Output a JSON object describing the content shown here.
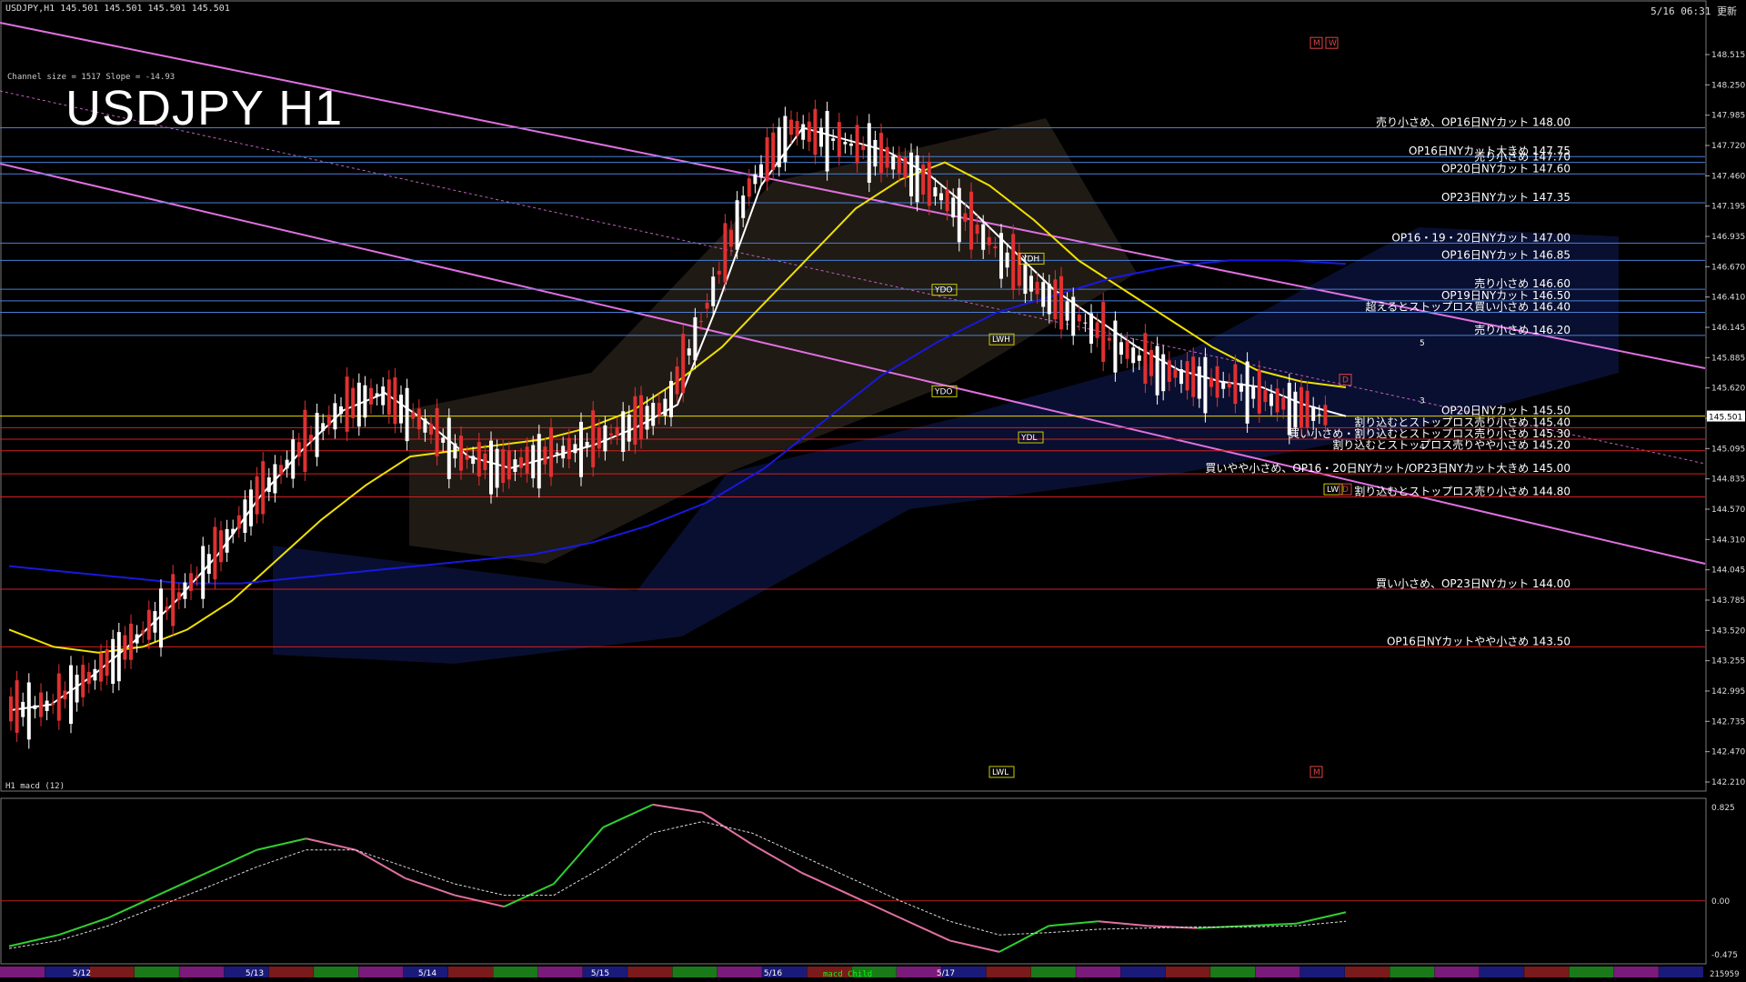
{
  "header": {
    "symbol_line": "USDJPY,H1  145.501 145.501 145.501 145.501",
    "server_time": "5/16 06:31 更新",
    "big_title": "USDJPY H1",
    "channel_info": "Channel size = 1517 Slope = -14.93"
  },
  "chart_data": {
    "type": "line",
    "symbol": "USDJPY",
    "timeframe": "H1",
    "y_axis": {
      "range": [
        142.25,
        148.95
      ],
      "tick_labels": [
        "148.515",
        "148.250",
        "147.985",
        "147.720",
        "147.460",
        "147.195",
        "146.935",
        "146.670",
        "146.410",
        "146.145",
        "145.885",
        "145.620",
        "145.360",
        "145.095",
        "144.835",
        "144.570",
        "144.310",
        "144.045",
        "143.785",
        "143.520",
        "143.255",
        "142.995",
        "142.735",
        "142.470",
        "142.210"
      ]
    },
    "current_price": "145.501",
    "x_axis": {
      "tick_labels": [
        "5/12",
        "5/13",
        "5/14",
        "5/15",
        "5/16",
        "5/17"
      ]
    },
    "levels": [
      {
        "price": 148.0,
        "label": "売り小さめ、OP16日NYカット 148.00",
        "color": "#4a7fd6"
      },
      {
        "price": 147.75,
        "label": "OP16日NYカット大きめ 147.75",
        "color": "#4a7fd6"
      },
      {
        "price": 147.7,
        "label": "売り小さめ 147.70",
        "color": "#4a7fd6"
      },
      {
        "price": 147.6,
        "label": "OP20日NYカット 147.60",
        "color": "#4a7fd6"
      },
      {
        "price": 147.35,
        "label": "OP23日NYカット 147.35",
        "color": "#4a7fd6"
      },
      {
        "price": 147.0,
        "label": "OP16・19・20日NYカット 147.00",
        "color": "#4a7fd6"
      },
      {
        "price": 146.85,
        "label": "OP16日NYカット 146.85",
        "color": "#4a7fd6"
      },
      {
        "price": 146.6,
        "label": "売り小さめ 146.60",
        "color": "#4a7fd6"
      },
      {
        "price": 146.5,
        "label": "OP19日NYカット 146.50",
        "color": "#4a7fd6"
      },
      {
        "price": 146.4,
        "label": "超えるとストップロス買い小さめ 146.40",
        "color": "#4a7fd6"
      },
      {
        "price": 146.2,
        "label": "売り小さめ 146.20",
        "color": "#4a7fd6"
      },
      {
        "price": 145.5,
        "label": "OP20日NYカット 145.50",
        "color": "#e8d800"
      },
      {
        "price": 145.4,
        "label": "割り込むとストップロス売り小さめ 145.40",
        "color": "#d42020"
      },
      {
        "price": 145.3,
        "label": "買い小さめ・割り込むとストップロス売り小さめ 145.30",
        "color": "#d42020"
      },
      {
        "price": 145.2,
        "label": "割り込むとストップロス売りやや小さめ 145.20",
        "color": "#d42020"
      },
      {
        "price": 145.0,
        "label": "買いやや小さめ、OP16・20日NYカット/OP23日NYカット大きめ 145.00",
        "color": "#d42020"
      },
      {
        "price": 144.8,
        "label": "割り込むとストップロス売り小さめ 144.80",
        "color": "#d42020"
      },
      {
        "price": 144.0,
        "label": "買い小さめ、OP23日NYカット 144.00",
        "color": "#d42020"
      },
      {
        "price": 143.5,
        "label": "OP16日NYカットやや小さめ 143.50",
        "color": "#d42020"
      }
    ],
    "markers": [
      {
        "text": "YDH",
        "price": 146.85
      },
      {
        "text": "YDO",
        "price": 146.58
      },
      {
        "text": "YDO",
        "price": 145.7
      },
      {
        "text": "YDL",
        "price": 145.3
      },
      {
        "text": "LWH",
        "price": 146.15
      },
      {
        "text": "LWL",
        "price": 142.4
      },
      {
        "text": "D",
        "price": 145.8
      },
      {
        "text": "M",
        "price": 148.72
      },
      {
        "text": "W",
        "price": 148.72
      },
      {
        "text": "M",
        "price": 142.4
      },
      {
        "text": "LW",
        "price": 144.85
      },
      {
        "text": "D",
        "price": 144.85
      },
      {
        "text": "5",
        "price": 146.12
      },
      {
        "text": "3",
        "price": 145.62
      },
      {
        "text": "4",
        "price": 145.22
      }
    ],
    "series": [
      {
        "color": "#ffffff",
        "values": [
          142.95,
          143.0,
          143.25,
          143.55,
          143.9,
          144.3,
          144.8,
          145.2,
          145.55,
          145.7,
          145.45,
          145.15,
          145.05,
          145.15,
          145.25,
          145.4,
          145.6,
          146.5,
          147.5,
          148.0,
          147.9,
          147.8,
          147.6,
          147.3,
          146.95,
          146.6,
          146.35,
          146.1,
          145.9,
          145.8,
          145.75,
          145.6,
          145.5
        ]
      },
      {
        "color": "#f0e000",
        "values": [
          143.65,
          143.5,
          143.45,
          143.5,
          143.65,
          143.9,
          144.25,
          144.6,
          144.9,
          145.15,
          145.2,
          145.25,
          145.3,
          145.4,
          145.55,
          145.8,
          146.1,
          146.5,
          146.9,
          147.3,
          147.55,
          147.7,
          147.5,
          147.2,
          146.85,
          146.6,
          146.35,
          146.1,
          145.9,
          145.8,
          145.75
        ]
      },
      {
        "color": "#1818e0",
        "values": [
          144.2,
          144.15,
          144.1,
          144.05,
          144.05,
          144.1,
          144.15,
          144.2,
          144.25,
          144.3,
          144.4,
          144.55,
          144.75,
          145.05,
          145.45,
          145.85,
          146.15,
          146.4,
          146.55,
          146.7,
          146.8,
          146.85,
          146.85,
          146.82
        ]
      }
    ],
    "macd": {
      "label": "H1 macd (12)",
      "range": [
        -0.475,
        0.825
      ],
      "tick_labels": [
        "0.825",
        "0.00",
        "-0.475"
      ],
      "main": [
        -0.4,
        -0.3,
        -0.15,
        0.05,
        0.25,
        0.45,
        0.55,
        0.45,
        0.2,
        0.05,
        -0.05,
        0.15,
        0.65,
        0.85,
        0.78,
        0.5,
        0.25,
        0.05,
        -0.15,
        -0.35,
        -0.45,
        -0.22,
        -0.18,
        -0.22,
        -0.24,
        -0.22,
        -0.2,
        -0.1
      ],
      "signal": [
        -0.42,
        -0.35,
        -0.22,
        -0.05,
        0.12,
        0.3,
        0.45,
        0.45,
        0.3,
        0.15,
        0.05,
        0.05,
        0.3,
        0.6,
        0.7,
        0.6,
        0.4,
        0.2,
        0.0,
        -0.18,
        -0.3,
        -0.28,
        -0.25,
        -0.24,
        -0.23,
        -0.23,
        -0.22,
        -0.18
      ]
    }
  },
  "footer": {
    "volume_label": "215959",
    "indicator_label": "macd Child"
  }
}
